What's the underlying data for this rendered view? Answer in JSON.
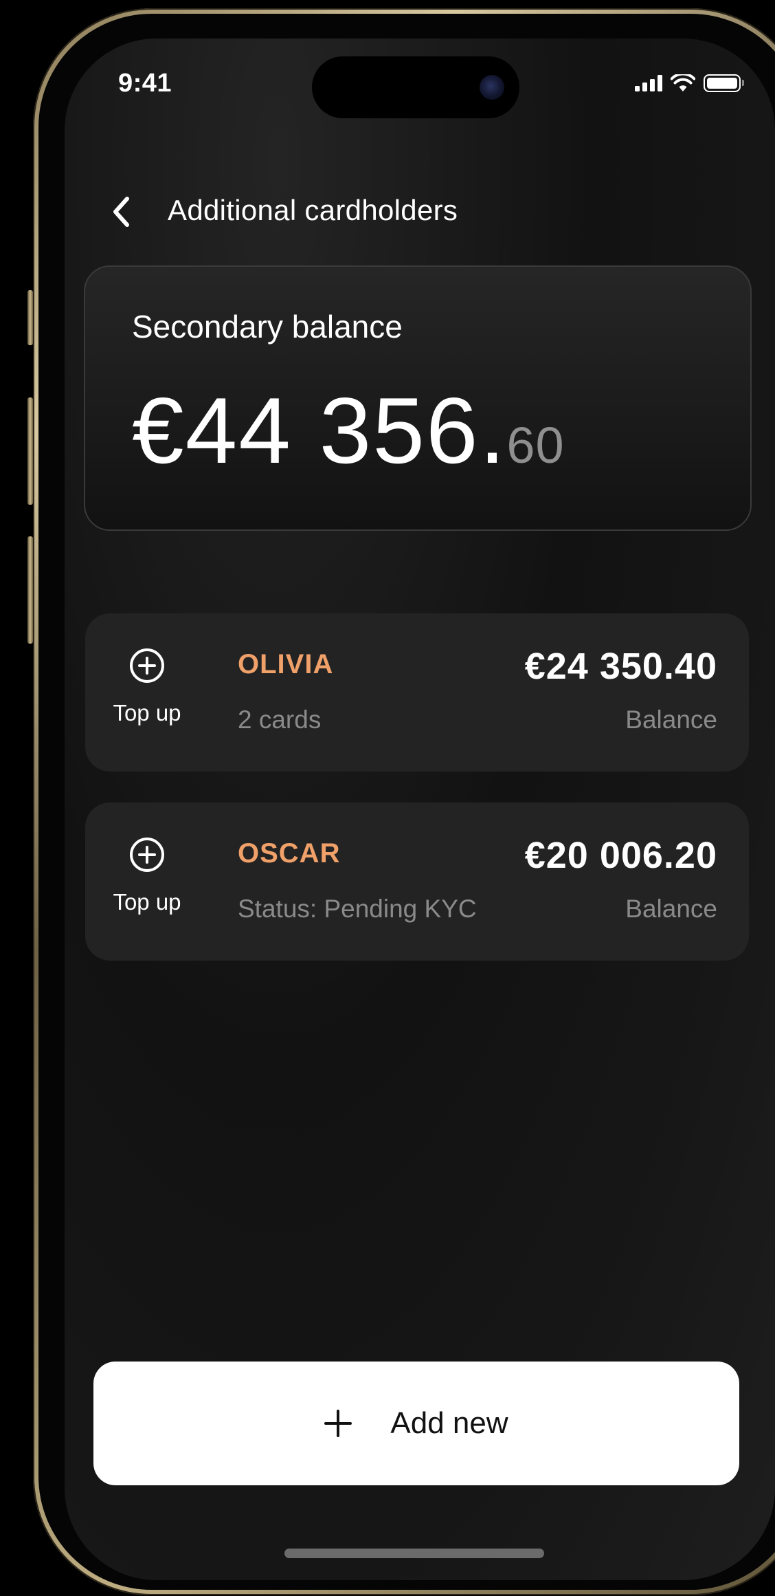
{
  "status_bar": {
    "time": "9:41"
  },
  "header": {
    "title": "Additional cardholders",
    "back_icon": "chevron-left-icon"
  },
  "balance_card": {
    "label": "Secondary balance",
    "amount_main": "€44 356.",
    "amount_cents": "60"
  },
  "cardholders": [
    {
      "name": "OLIVIA",
      "subtitle": "2 cards",
      "balance": "€24 350.40",
      "balance_label": "Balance",
      "action_label": "Top up",
      "action_icon": "plus-circle-icon"
    },
    {
      "name": "OSCAR",
      "subtitle": "Status: Pending KYC",
      "balance": "€20 006.20",
      "balance_label": "Balance",
      "action_label": "Top up",
      "action_icon": "plus-circle-icon"
    }
  ],
  "add_button": {
    "label": "Add new",
    "icon": "plus-icon"
  },
  "colors": {
    "accent": "#f0a069",
    "background": "#141414",
    "card": "#232323",
    "muted_text": "#8a8a8a",
    "button_bg": "#ffffff"
  }
}
